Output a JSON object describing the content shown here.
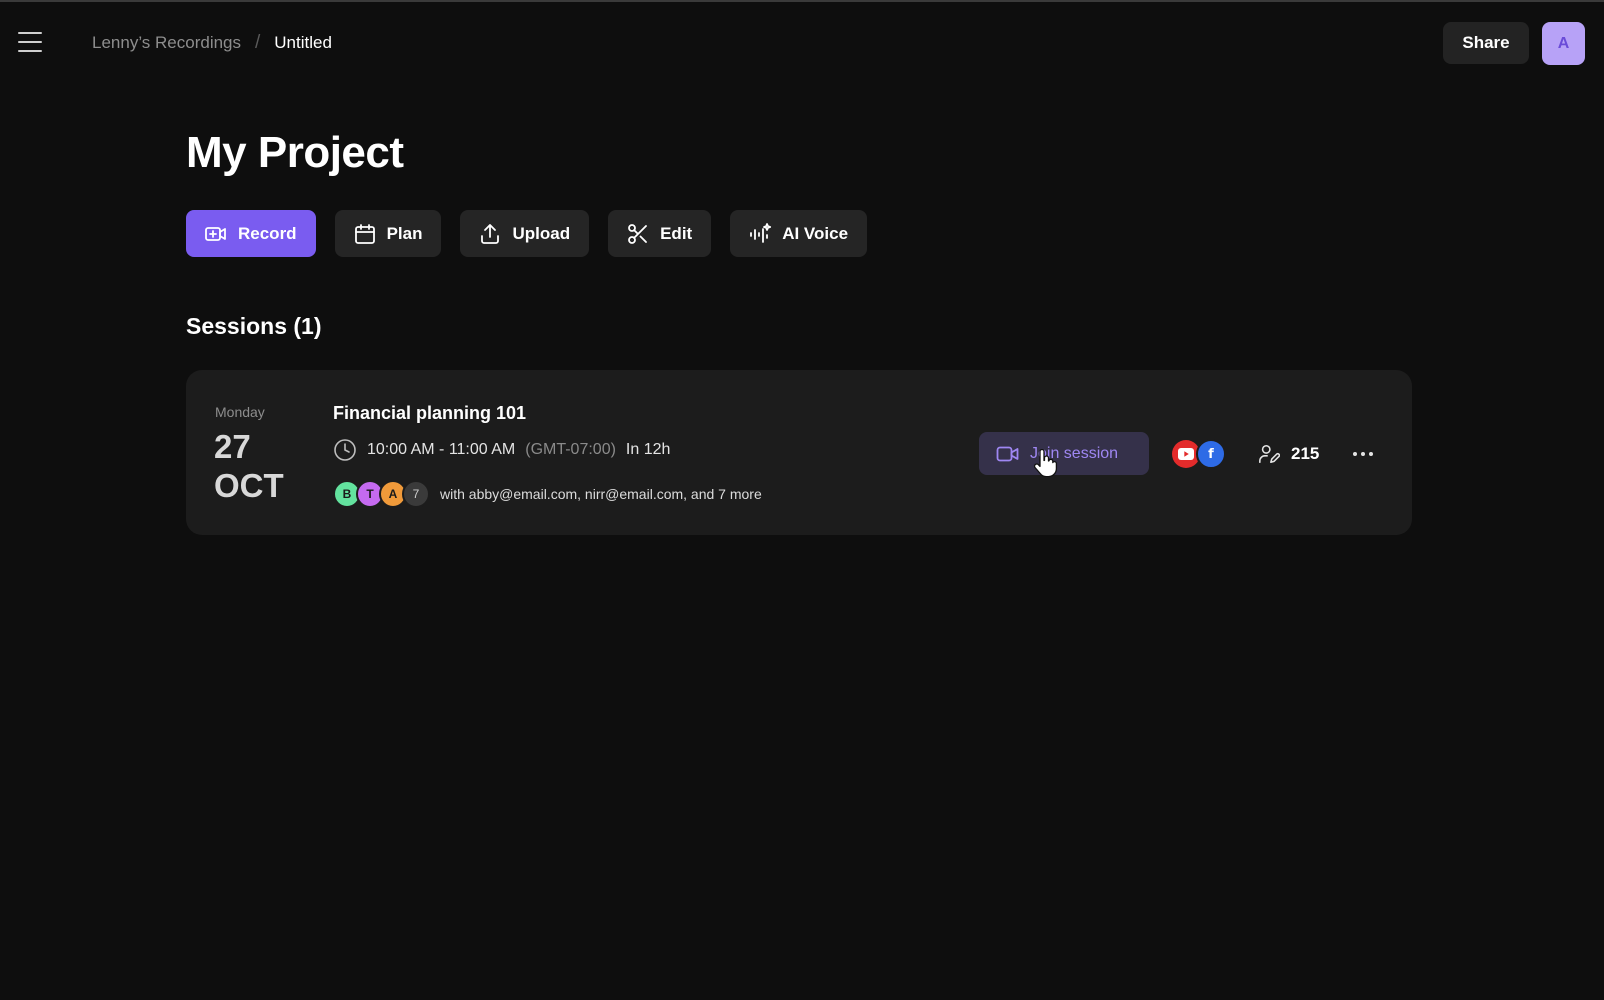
{
  "header": {
    "breadcrumb_parent": "Lenny’s Recordings",
    "breadcrumb_separator": "/",
    "breadcrumb_current": "Untitled",
    "share_label": "Share",
    "avatar_initial": "A"
  },
  "page": {
    "title": "My Project"
  },
  "toolbar": {
    "record_label": "Record",
    "plan_label": "Plan",
    "upload_label": "Upload",
    "edit_label": "Edit",
    "ai_voice_label": "AI Voice"
  },
  "sessions": {
    "heading": "Sessions (1)",
    "items": [
      {
        "day_name": "Monday",
        "day_number": "27",
        "month": "OCT",
        "title": "Financial planning 101",
        "time_range": "10:00 AM - 11:00 AM",
        "timezone": "(GMT-07:00)",
        "relative_time": "In 12h",
        "attendees": [
          "B",
          "T",
          "A"
        ],
        "attendees_more": "7",
        "with_text": "with abby@email.com, nirr@email.com, and 7 more",
        "join_label": "Join session",
        "platforms": [
          "youtube-icon",
          "facebook-icon"
        ],
        "facebook_glyph": "f",
        "viewer_count": "215"
      }
    ]
  },
  "colors": {
    "background": "#0e0e0e",
    "card": "#1c1c1c",
    "accent": "#7a5cf0",
    "join_text": "#9f87f3",
    "youtube": "#e32b2b",
    "facebook": "#2e6be6"
  }
}
